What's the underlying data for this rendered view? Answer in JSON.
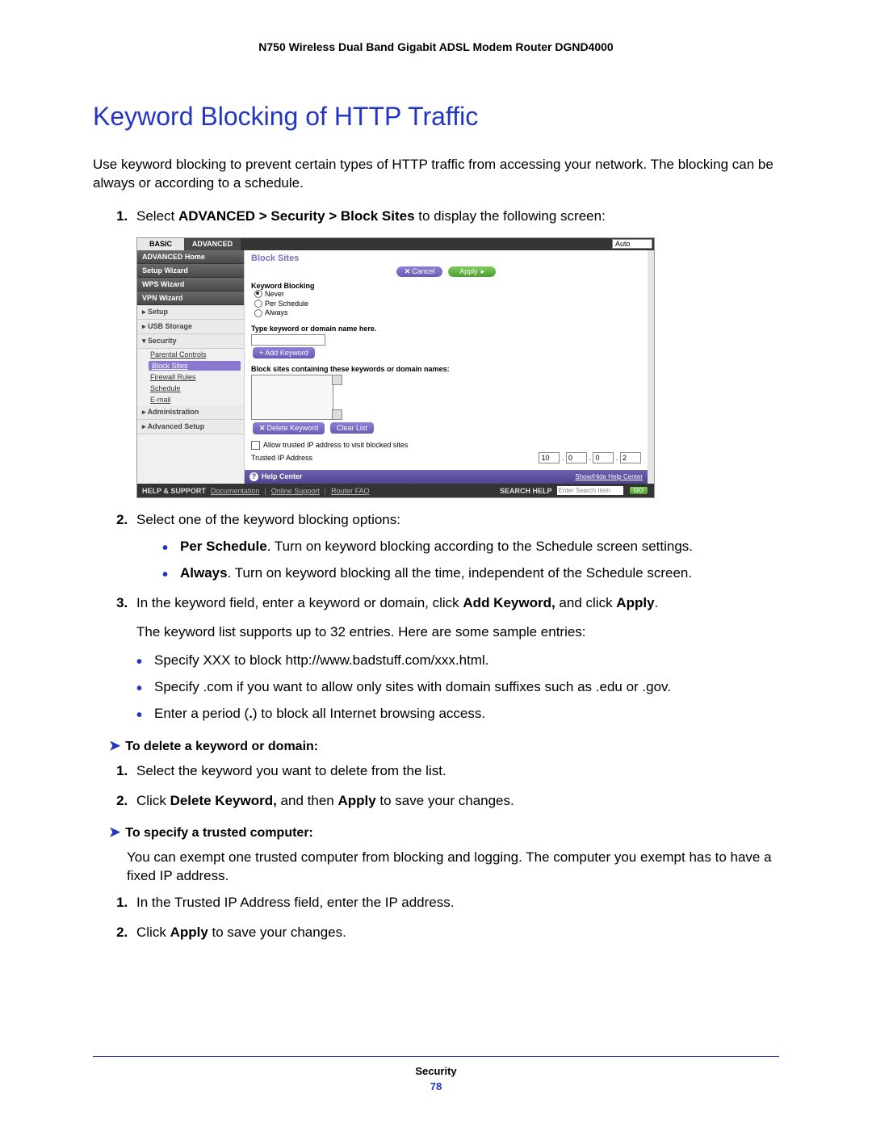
{
  "doc_header": "N750 Wireless Dual Band Gigabit ADSL Modem Router DGND4000",
  "title": "Keyword Blocking of HTTP Traffic",
  "intro": "Use keyword blocking to prevent certain types of HTTP traffic from accessing your network. The blocking can be always or according to a schedule.",
  "steps": {
    "s1a": "Select ",
    "s1b": "ADVANCED > Security > Block Sites",
    "s1c": " to display the following screen:",
    "s2": "Select one of the keyword blocking options:",
    "s2_per_b": "Per Schedule",
    "s2_per": ". Turn on keyword blocking according to the Schedule screen settings.",
    "s2_alw_b": "Always",
    "s2_alw": ". Turn on keyword blocking all the time, independent of the Schedule screen.",
    "s3a": "In the keyword field, enter a keyword or domain, click ",
    "s3b": "Add Keyword,",
    "s3c": " and click ",
    "s3d": "Apply",
    "s3e": ".",
    "s3_note": "The keyword list supports up to 32 entries. Here are some sample entries:",
    "s3_b1": "Specify XXX to block http://www.badstuff.com/xxx.html.",
    "s3_b2": "Specify .com if you want to allow only sites with domain suffixes such as .edu or .gov.",
    "s3_b3a": "Enter a period (",
    "s3_b3b": ".",
    "s3_b3c": ") to block all Internet browsing access."
  },
  "delete_heading": "To delete a keyword or domain:",
  "delete_s1": "Select the keyword you want to delete from the list.",
  "delete_s2a": "Click ",
  "delete_s2b": "Delete Keyword,",
  "delete_s2c": " and then ",
  "delete_s2d": "Apply",
  "delete_s2e": " to save your changes.",
  "trusted_heading": "To specify a trusted computer:",
  "trusted_intro": "You can exempt one trusted computer from blocking and logging. The computer you exempt has to have a fixed IP address.",
  "trusted_s1": "In the Trusted IP Address field, enter the IP address.",
  "trusted_s2a": "Click ",
  "trusted_s2b": "Apply",
  "trusted_s2c": " to save your changes.",
  "footer_label": "Security",
  "footer_page": "78",
  "ss": {
    "tab_basic": "BASIC",
    "tab_adv": "ADVANCED",
    "auto": "Auto",
    "side": {
      "home": "ADVANCED Home",
      "setupwiz": "Setup Wizard",
      "wps": "WPS Wizard",
      "vpn": "VPN Wizard",
      "setup": "▸ Setup",
      "usb": "▸ USB Storage",
      "security": "▾ Security",
      "parental": "Parental Controls",
      "blocksites": "Block Sites",
      "firewall": "Firewall Rules",
      "schedule": "Schedule",
      "email": "E-mail",
      "admin": "▸ Administration",
      "advsetup": "▸ Advanced Setup"
    },
    "main": {
      "title": "Block Sites",
      "cancel": "Cancel",
      "apply": "Apply",
      "kb_label": "Keyword Blocking",
      "r_never": "Never",
      "r_sched": "Per Schedule",
      "r_always": "Always",
      "type_label": "Type keyword or domain name here.",
      "add_kw": "+ Add Keyword",
      "list_label": "Block sites containing these keywords or domain names:",
      "del_kw": "Delete Keyword",
      "clear": "Clear List",
      "allow_cb": "Allow trusted IP address to visit blocked sites",
      "trusted_label": "Trusted IP Address",
      "ip": [
        "10",
        "0",
        "0",
        "2"
      ],
      "helpcenter": "Help Center",
      "showhide": "Show/Hide Help Center"
    },
    "footer": {
      "hs": "HELP & SUPPORT",
      "doc": "Documentation",
      "online": "Online Support",
      "faq": "Router FAQ",
      "search": "SEARCH HELP",
      "placeholder": "Enter Search Item",
      "go": "GO"
    }
  }
}
